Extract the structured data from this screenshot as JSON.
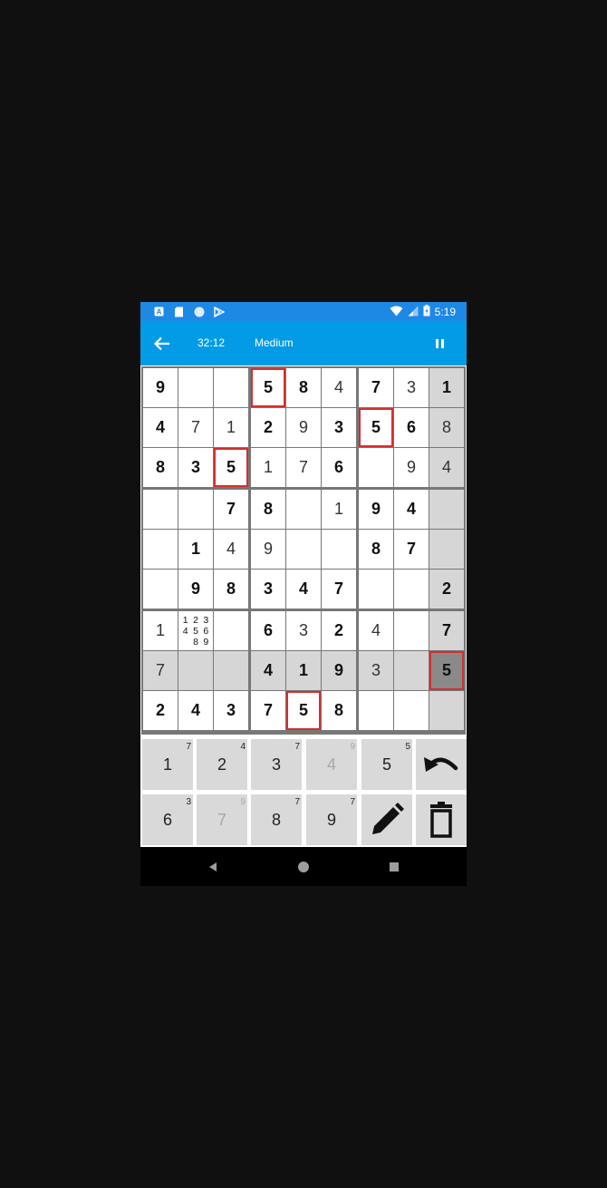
{
  "status_bar": {
    "time": "5:19",
    "left_icons": [
      "a-notification-icon",
      "sd-card-icon",
      "circle-icon",
      "play-store-icon"
    ],
    "right_icons": [
      "wifi-icon",
      "signal-icon",
      "battery-icon"
    ]
  },
  "app_bar": {
    "timer": "32:12",
    "difficulty": "Medium",
    "back_icon": "arrow-left-icon",
    "pause_icon": "pause-icon"
  },
  "board": {
    "rows": [
      [
        {
          "v": "9",
          "t": "given"
        },
        {
          "v": "",
          "t": ""
        },
        {
          "v": "",
          "t": ""
        },
        {
          "v": "5",
          "t": "given",
          "err": true
        },
        {
          "v": "8",
          "t": "given"
        },
        {
          "v": "4",
          "t": "user"
        },
        {
          "v": "7",
          "t": "given"
        },
        {
          "v": "3",
          "t": "user"
        },
        {
          "v": "1",
          "t": "given",
          "hl": true
        }
      ],
      [
        {
          "v": "4",
          "t": "given"
        },
        {
          "v": "7",
          "t": "user"
        },
        {
          "v": "1",
          "t": "user"
        },
        {
          "v": "2",
          "t": "given"
        },
        {
          "v": "9",
          "t": "user"
        },
        {
          "v": "3",
          "t": "given"
        },
        {
          "v": "5",
          "t": "given",
          "err": true
        },
        {
          "v": "6",
          "t": "given"
        },
        {
          "v": "8",
          "t": "user",
          "hl": true
        }
      ],
      [
        {
          "v": "8",
          "t": "given"
        },
        {
          "v": "3",
          "t": "given"
        },
        {
          "v": "5",
          "t": "given",
          "err": true
        },
        {
          "v": "1",
          "t": "user"
        },
        {
          "v": "7",
          "t": "user"
        },
        {
          "v": "6",
          "t": "given"
        },
        {
          "v": "",
          "t": ""
        },
        {
          "v": "9",
          "t": "user"
        },
        {
          "v": "4",
          "t": "user",
          "hl": true
        }
      ],
      [
        {
          "v": "",
          "t": ""
        },
        {
          "v": "",
          "t": ""
        },
        {
          "v": "7",
          "t": "given"
        },
        {
          "v": "8",
          "t": "given"
        },
        {
          "v": "",
          "t": ""
        },
        {
          "v": "1",
          "t": "user"
        },
        {
          "v": "9",
          "t": "given"
        },
        {
          "v": "4",
          "t": "given"
        },
        {
          "v": "",
          "t": "",
          "hl": true
        }
      ],
      [
        {
          "v": "",
          "t": ""
        },
        {
          "v": "1",
          "t": "given"
        },
        {
          "v": "4",
          "t": "user"
        },
        {
          "v": "9",
          "t": "user"
        },
        {
          "v": "",
          "t": ""
        },
        {
          "v": "",
          "t": ""
        },
        {
          "v": "8",
          "t": "given"
        },
        {
          "v": "7",
          "t": "given"
        },
        {
          "v": "",
          "t": "",
          "hl": true
        }
      ],
      [
        {
          "v": "",
          "t": ""
        },
        {
          "v": "9",
          "t": "given"
        },
        {
          "v": "8",
          "t": "given"
        },
        {
          "v": "3",
          "t": "given"
        },
        {
          "v": "4",
          "t": "given"
        },
        {
          "v": "7",
          "t": "given"
        },
        {
          "v": "",
          "t": ""
        },
        {
          "v": "",
          "t": ""
        },
        {
          "v": "2",
          "t": "given",
          "hl": true
        }
      ],
      [
        {
          "v": "1",
          "t": "user"
        },
        {
          "v": "",
          "t": "notes",
          "notes": [
            "1",
            "2",
            "3",
            "4",
            "5",
            "6",
            "",
            "8",
            "9"
          ]
        },
        {
          "v": "",
          "t": ""
        },
        {
          "v": "6",
          "t": "given"
        },
        {
          "v": "3",
          "t": "user"
        },
        {
          "v": "2",
          "t": "given"
        },
        {
          "v": "4",
          "t": "user"
        },
        {
          "v": "",
          "t": ""
        },
        {
          "v": "7",
          "t": "given",
          "hl": true
        }
      ],
      [
        {
          "v": "7",
          "t": "user",
          "hl": true
        },
        {
          "v": "",
          "t": "",
          "hl": true
        },
        {
          "v": "",
          "t": "",
          "hl": true
        },
        {
          "v": "4",
          "t": "given",
          "hl": true
        },
        {
          "v": "1",
          "t": "given",
          "hl": true
        },
        {
          "v": "9",
          "t": "given",
          "hl": true
        },
        {
          "v": "3",
          "t": "user",
          "hl": true
        },
        {
          "v": "",
          "t": "",
          "hl": true
        },
        {
          "v": "5",
          "t": "given",
          "sel": true,
          "err": true
        }
      ],
      [
        {
          "v": "2",
          "t": "given"
        },
        {
          "v": "4",
          "t": "given"
        },
        {
          "v": "3",
          "t": "given"
        },
        {
          "v": "7",
          "t": "given"
        },
        {
          "v": "5",
          "t": "given",
          "err": true
        },
        {
          "v": "8",
          "t": "given"
        },
        {
          "v": "",
          "t": ""
        },
        {
          "v": "",
          "t": ""
        },
        {
          "v": "",
          "t": "",
          "hl": true
        }
      ]
    ]
  },
  "keypad": {
    "numbers": [
      {
        "n": "1",
        "count": "7",
        "disabled": false
      },
      {
        "n": "2",
        "count": "4",
        "disabled": false
      },
      {
        "n": "3",
        "count": "7",
        "disabled": false
      },
      {
        "n": "4",
        "count": "9",
        "disabled": true
      },
      {
        "n": "5",
        "count": "5",
        "disabled": false
      },
      {
        "n": "6",
        "count": "3",
        "disabled": false
      },
      {
        "n": "7",
        "count": "9",
        "disabled": true
      },
      {
        "n": "8",
        "count": "7",
        "disabled": false
      },
      {
        "n": "9",
        "count": "7",
        "disabled": false
      }
    ],
    "undo_icon": "undo-icon",
    "pencil_icon": "pencil-icon",
    "erase_icon": "trash-icon"
  },
  "nav_bar": {
    "icons": [
      "back-triangle-icon",
      "home-circle-icon",
      "recents-square-icon"
    ]
  },
  "colors": {
    "status_bar": "#1e88e5",
    "app_bar": "#039be5",
    "error_border": "#d32f2f",
    "highlight": "#d6d6d6",
    "selected": "#8a8a8a",
    "key_bg": "#d9d9d9"
  }
}
